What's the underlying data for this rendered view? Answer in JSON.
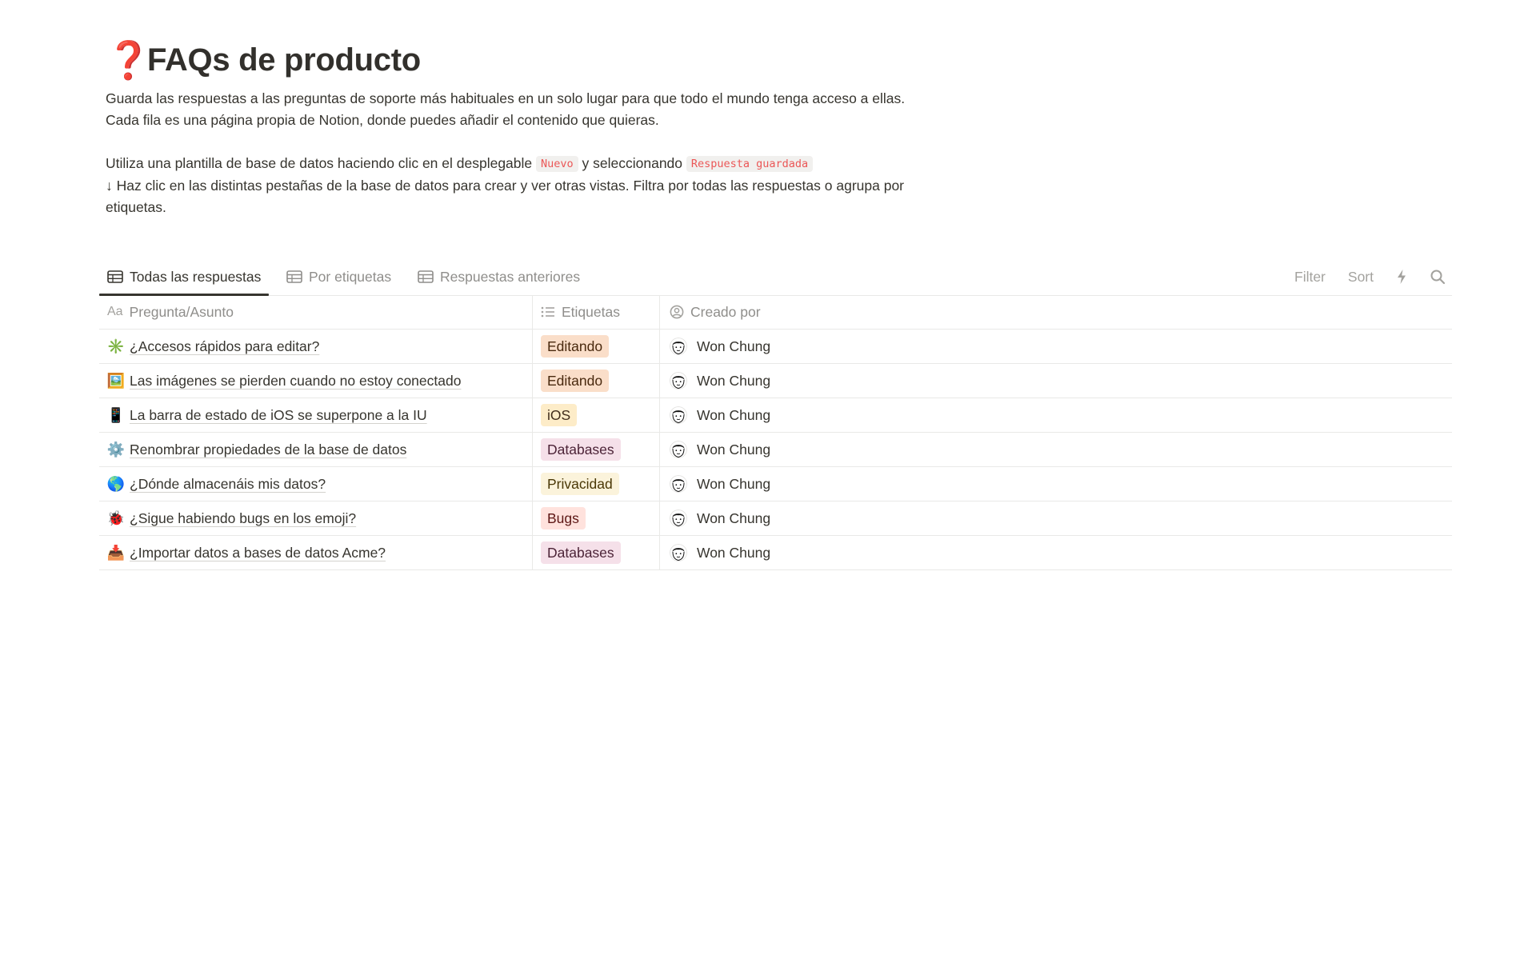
{
  "page": {
    "icon": "❓",
    "title": "FAQs de producto",
    "description": {
      "line1": "Guarda las respuestas a las preguntas de soporte más habituales en un solo lugar para que todo el mundo tenga acceso a ellas.",
      "line2": "Cada fila es una página propia de Notion, donde puedes añadir el contenido que quieras.",
      "line3_pre": "Utiliza una plantilla de base de datos haciendo clic en el desplegable ",
      "line3_code1": "Nuevo",
      "line3_mid": " y seleccionando ",
      "line3_code2": "Respuesta guardada",
      "line4": "↓ Haz clic en las distintas pestañas de la base de datos para crear y ver otras vistas. Filtra por todas las respuestas o agrupa por etiquetas."
    }
  },
  "tabs": [
    {
      "label": "Todas las respuestas",
      "icon": "table-icon",
      "active": true
    },
    {
      "label": "Por etiquetas",
      "icon": "table-icon",
      "active": false
    },
    {
      "label": "Respuestas anteriores",
      "icon": "table-icon",
      "active": false
    }
  ],
  "toolbar": {
    "filter": "Filter",
    "sort": "Sort",
    "automation_icon": "lightning-icon",
    "search_icon": "search-icon"
  },
  "columns": [
    {
      "label": "Pregunta/Asunto",
      "icon": "Aa"
    },
    {
      "label": "Etiquetas",
      "icon": "list-icon"
    },
    {
      "label": "Creado por",
      "icon": "person-circle-icon"
    }
  ],
  "rows": [
    {
      "emoji": "✳️",
      "title": "¿Accesos rápidos para editar?",
      "tag": "Editando",
      "creator": "Won Chung"
    },
    {
      "emoji": "🖼️",
      "title": "Las imágenes se pierden cuando no estoy conectado",
      "tag": "Editando",
      "creator": "Won Chung"
    },
    {
      "emoji": "📱",
      "title": "La barra de estado de iOS se superpone a la IU",
      "tag": "iOS",
      "creator": "Won Chung"
    },
    {
      "emoji": "⚙️",
      "title": "Renombrar propiedades de la base de datos",
      "tag": "Databases",
      "creator": "Won Chung"
    },
    {
      "emoji": "🌎",
      "title": "¿Dónde almacenáis mis datos?",
      "tag": "Privacidad",
      "creator": "Won Chung"
    },
    {
      "emoji": "🐞",
      "title": "¿Sigue habiendo bugs en los emoji?",
      "tag": "Bugs",
      "creator": "Won Chung"
    },
    {
      "emoji": "📥",
      "title": "¿Importar datos a bases de datos Acme?",
      "tag": "Databases",
      "creator": "Won Chung"
    }
  ],
  "tag_colors": {
    "Editando": {
      "bg": "#fadec9",
      "fg": "#49290e"
    },
    "iOS": {
      "bg": "#fdecc8",
      "fg": "#402c1b"
    },
    "Databases": {
      "bg": "#f5e0e9",
      "fg": "#4c2337"
    },
    "Privacidad": {
      "bg": "#fbf3db",
      "fg": "#4a3806"
    },
    "Bugs": {
      "bg": "#ffe2dd",
      "fg": "#5d1715"
    }
  }
}
